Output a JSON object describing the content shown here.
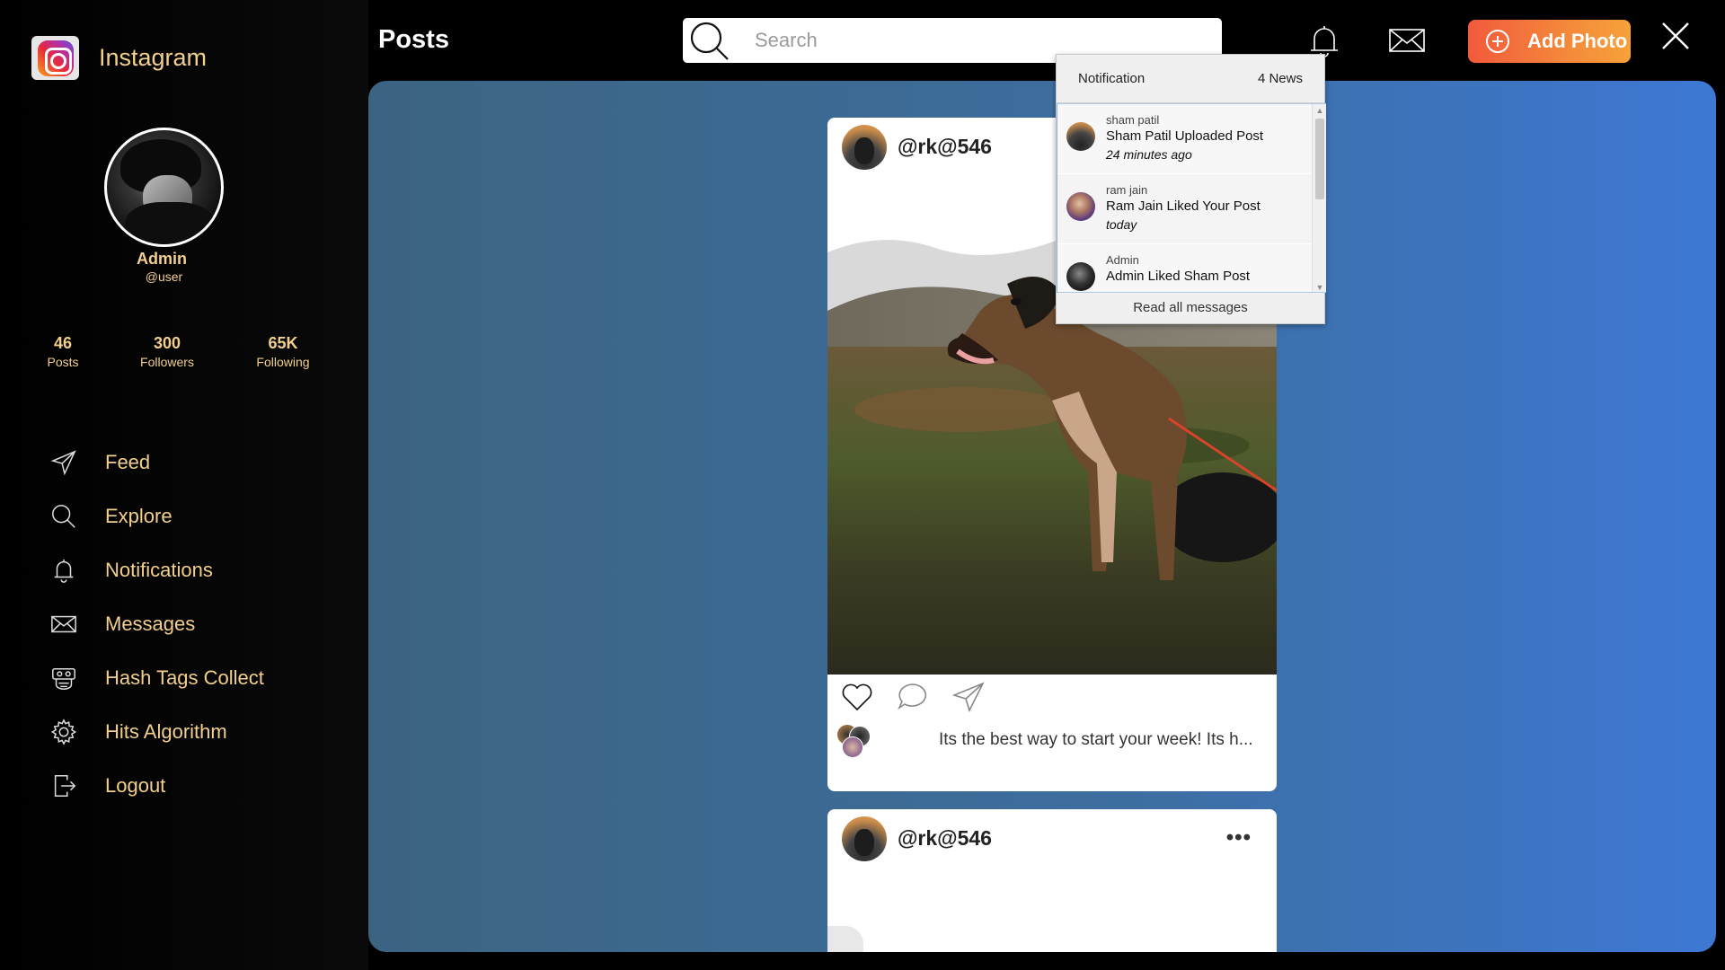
{
  "app": {
    "title": "Instagram"
  },
  "profile": {
    "name": "Admin",
    "handle": "@user",
    "stats": [
      {
        "value": "46",
        "label": "Posts"
      },
      {
        "value": "300",
        "label": "Followers"
      },
      {
        "value": "65K",
        "label": "Following"
      }
    ]
  },
  "nav": {
    "items": [
      {
        "label": "Feed",
        "icon": "send-icon"
      },
      {
        "label": "Explore",
        "icon": "search-icon"
      },
      {
        "label": "Notifications",
        "icon": "bell-icon"
      },
      {
        "label": "Messages",
        "icon": "envelope-icon"
      },
      {
        "label": "Hash Tags Collect",
        "icon": "hashtag-collect-icon"
      },
      {
        "label": "Hits Algorithm",
        "icon": "gear-icon"
      },
      {
        "label": "Logout",
        "icon": "logout-icon"
      }
    ]
  },
  "header": {
    "title": "Posts",
    "search_placeholder": "Search",
    "add_photo_label": "Add Photo"
  },
  "posts": [
    {
      "user": "@rk@546",
      "caption": "Its the best way to start your week! Its h..."
    },
    {
      "user": "@rk@546",
      "more": "•••"
    }
  ],
  "notifications": {
    "title": "Notification",
    "count_label": "4 News",
    "items": [
      {
        "name": "sham patil",
        "message": "Sham Patil Uploaded Post",
        "time": "24 minutes ago"
      },
      {
        "name": "ram jain",
        "message": "Ram Jain Liked Your Post",
        "time": "today"
      },
      {
        "name": "Admin",
        "message": "Admin Liked Sham Post",
        "time": ""
      }
    ],
    "footer_label": "Read all messages"
  },
  "colors": {
    "accent_gold": "#f3cf8e",
    "panel_start": "#3c6481",
    "panel_end": "#3d78d4",
    "button_start": "#f25a3c",
    "button_end": "#f6a23a"
  }
}
